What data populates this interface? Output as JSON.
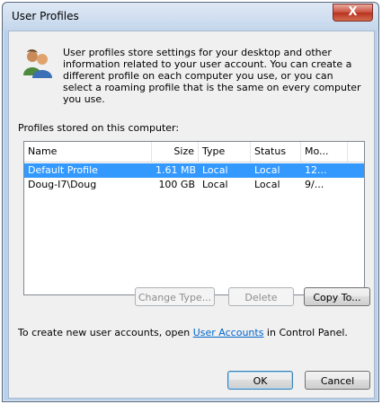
{
  "window": {
    "title": "User Profiles",
    "close_label": "X"
  },
  "intro": "User profiles store settings for your desktop and other information related to your user account. You can create a different profile on each computer you use, or you can select a roaming profile that is the same on every computer you use.",
  "profiles_label": "Profiles stored on this computer:",
  "columns": [
    "Name",
    "Size",
    "Type",
    "Status",
    "Mo..."
  ],
  "rows": [
    {
      "name": "Default Profile",
      "size": "1.61 MB",
      "type": "Local",
      "status": "Local",
      "modified": "12..."
    },
    {
      "name": "Doug-I7\\Doug",
      "size": "100 GB",
      "type": "Local",
      "status": "Local",
      "modified": "9/..."
    }
  ],
  "buttons": {
    "change_type": "Change Type...",
    "delete": "Delete",
    "copy_to": "Copy To...",
    "ok": "OK",
    "cancel": "Cancel"
  },
  "footer": {
    "prefix": "To create new user accounts, open ",
    "link": "User Accounts",
    "suffix": " in Control Panel."
  }
}
